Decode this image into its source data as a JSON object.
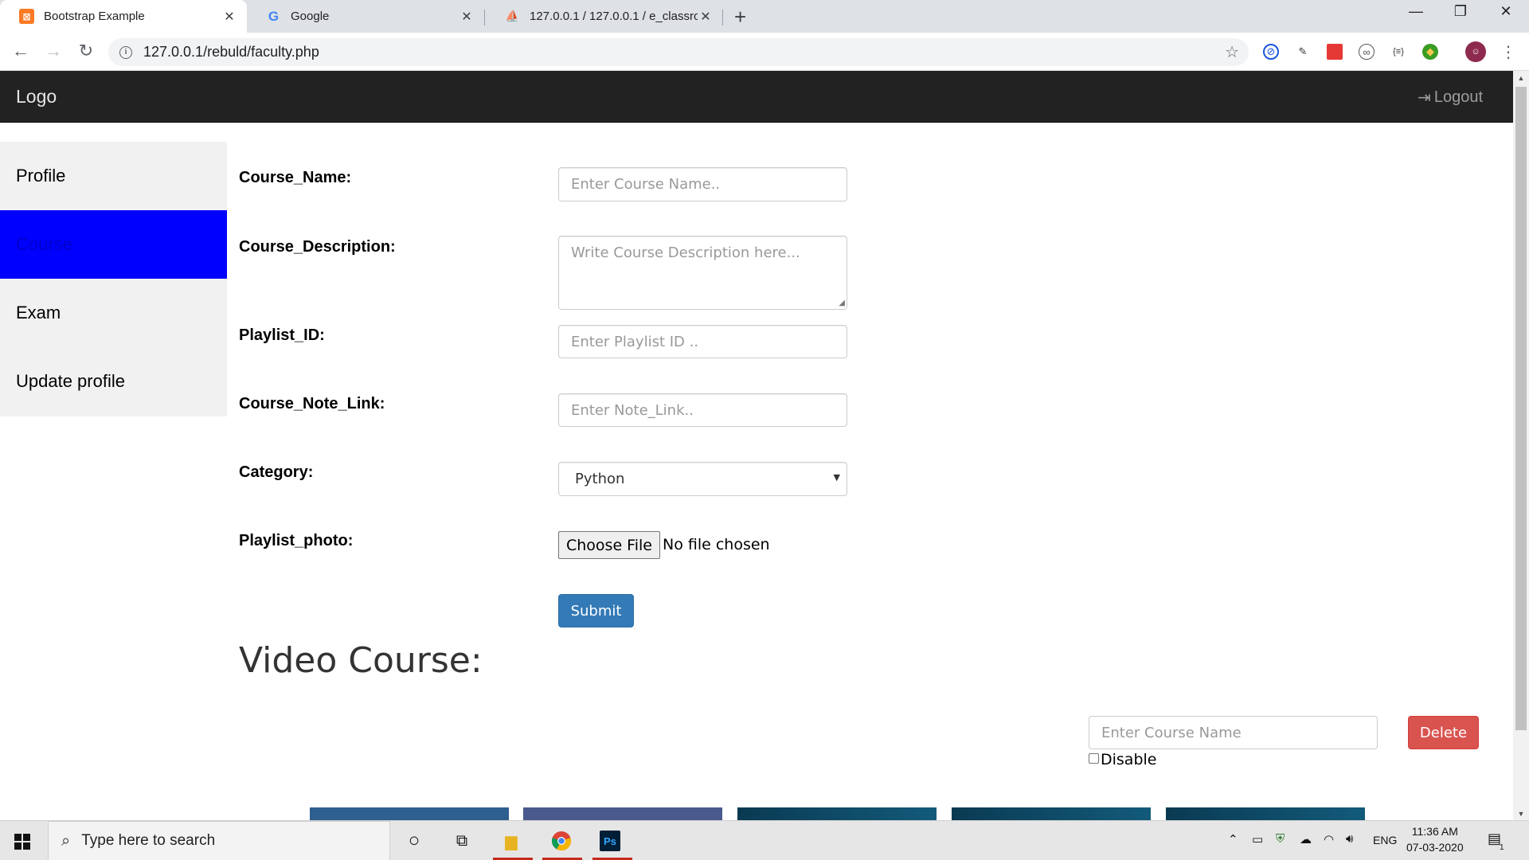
{
  "browser": {
    "tabs": [
      {
        "title": "Bootstrap Example",
        "active": true
      },
      {
        "title": "Google",
        "active": false
      },
      {
        "title": "127.0.0.1 / 127.0.0.1 / e_classroo",
        "active": false
      }
    ],
    "url": "127.0.0.1/rebuld/faculty.php"
  },
  "navbar": {
    "brand": "Logo",
    "logout": "Logout"
  },
  "sidebar": {
    "items": [
      {
        "label": "Profile"
      },
      {
        "label": "Course"
      },
      {
        "label": "Exam"
      },
      {
        "label": "Update profile"
      }
    ],
    "active_color": "#0000ff"
  },
  "form": {
    "course_name": {
      "label": "Course_Name:",
      "placeholder": "Enter Course Name.."
    },
    "course_description": {
      "label": "Course_Description:",
      "placeholder": "Write Course Description here..."
    },
    "playlist_id": {
      "label": "Playlist_ID:",
      "placeholder": "Enter Playlist ID .."
    },
    "note_link": {
      "label": "Course_Note_Link:",
      "placeholder": "Enter Note_Link.."
    },
    "category": {
      "label": "Category:",
      "value": "Python"
    },
    "playlist_photo": {
      "label": "Playlist_photo:",
      "button": "Choose File",
      "status": "No file chosen"
    },
    "submit": "Submit"
  },
  "video_section": {
    "heading": "Video Course:",
    "course_name_placeholder": "Enter Course Name",
    "delete": "Delete",
    "disable": "Disable"
  },
  "taskbar": {
    "search_placeholder": "Type here to search",
    "lang": "ENG",
    "time": "11:36 AM",
    "date": "07-03-2020",
    "notification_count": "1"
  },
  "colors": {
    "navbar_bg": "#222222",
    "submit_bg": "#337ab7",
    "delete_bg": "#d9534f"
  }
}
